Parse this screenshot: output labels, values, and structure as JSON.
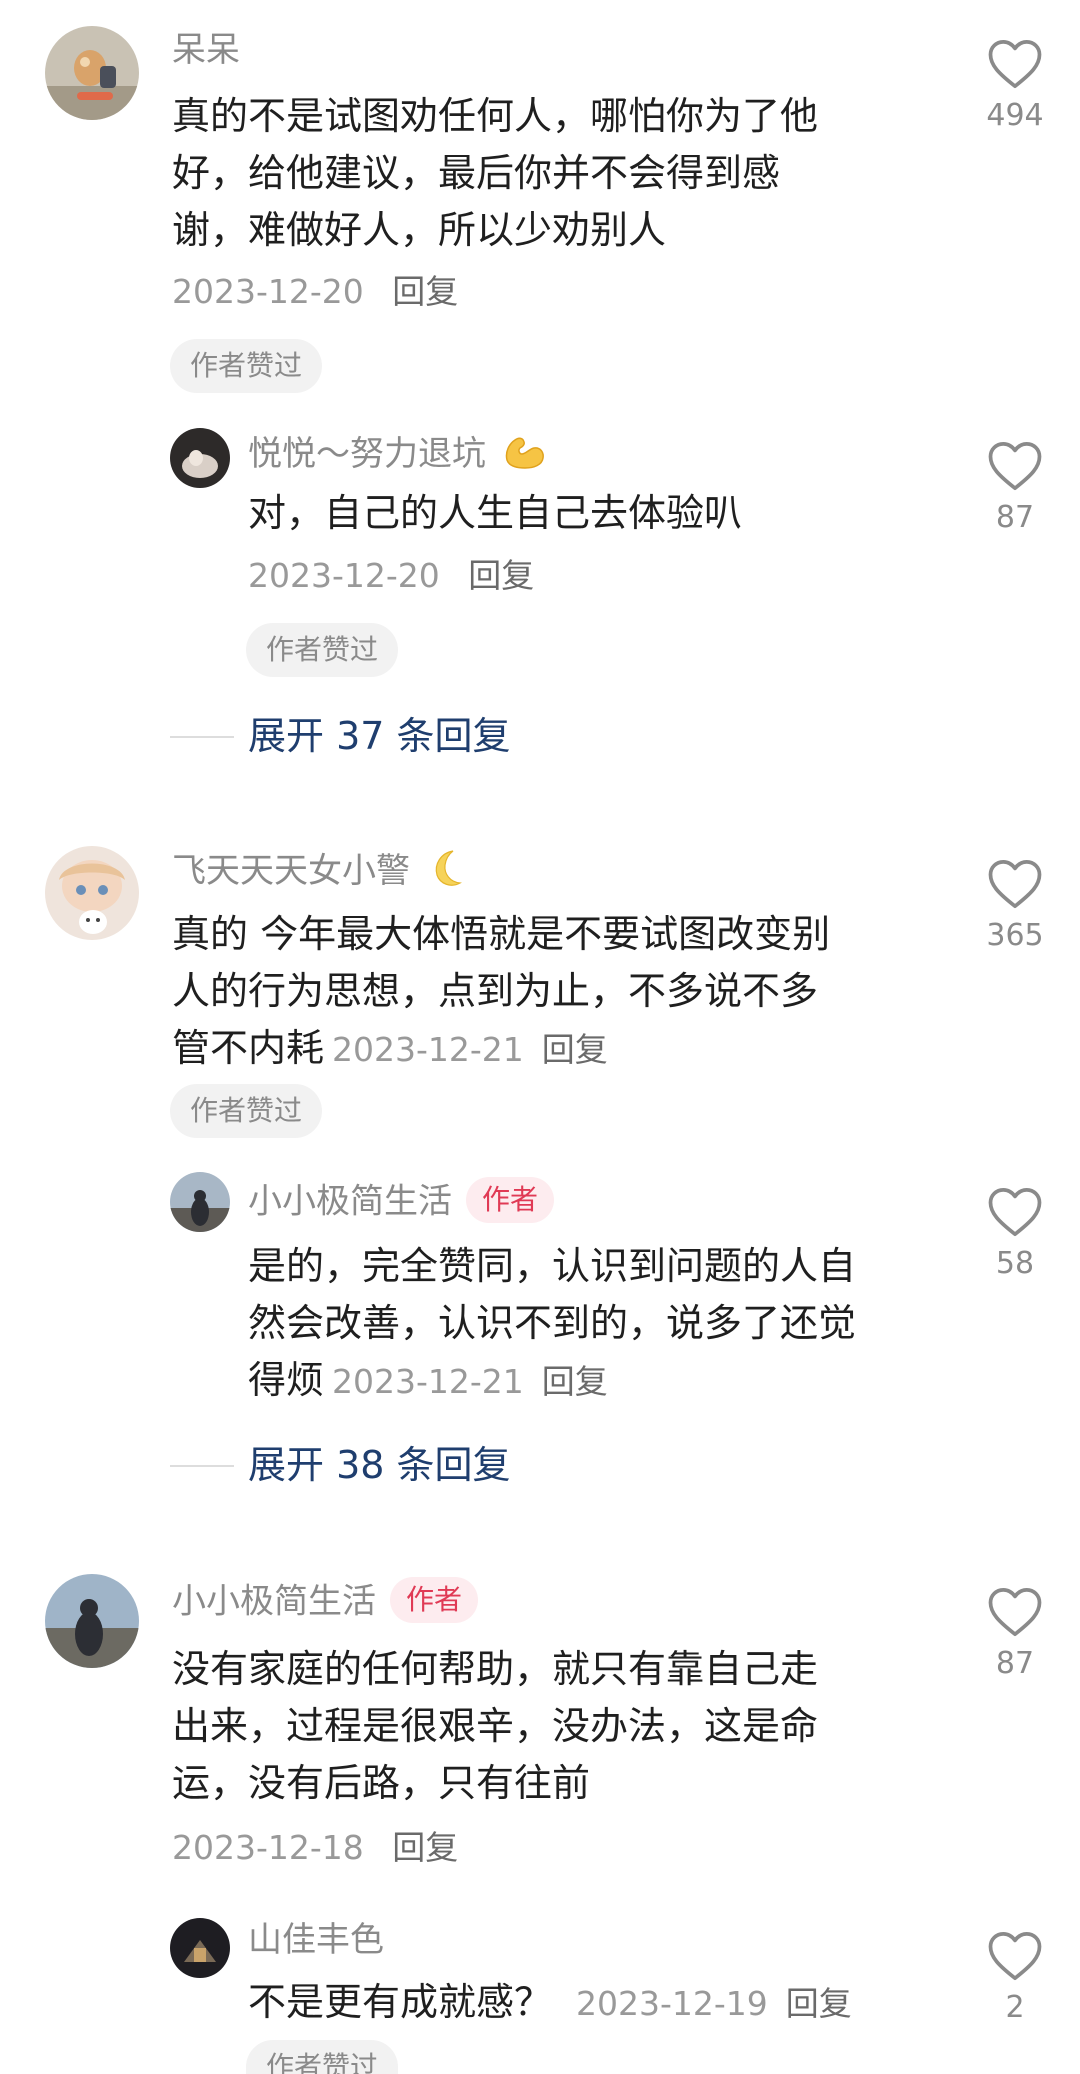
{
  "comments": [
    {
      "user": "呆呆",
      "text_lines": [
        "真的不是试图劝任何人，哪怕你为了他",
        "好，给他建议，最后你并不会得到感",
        "谢，难做好人，所以少劝别人"
      ],
      "date": "2023-12-20",
      "reply_label": "回复",
      "liked_label": "作者赞过",
      "likes": "494",
      "replies": [
        {
          "user": "悦悦～努力退坑",
          "emoji": "flexed-biceps-emoji",
          "text": "对，自己的人生自己去体验叭",
          "date": "2023-12-20",
          "reply_label": "回复",
          "liked_label": "作者赞过",
          "likes": "87"
        }
      ],
      "expand_label": "展开 37 条回复"
    },
    {
      "user": "飞天天天女小警",
      "emoji": "crescent-moon-emoji",
      "text_lines": [
        "真的 今年最大体悟就是不要试图改变别",
        "人的行为思想，点到为止，不多说不多",
        "管不内耗"
      ],
      "date": "2023-12-21",
      "reply_label": "回复",
      "liked_label": "作者赞过",
      "likes": "365",
      "replies": [
        {
          "user": "小小极简生活",
          "author_tag": "作者",
          "text_lines": [
            "是的，完全赞同，认识到问题的人自",
            "然会改善，认识不到的，说多了还觉",
            "得烦"
          ],
          "date": "2023-12-21",
          "reply_label": "回复",
          "likes": "58"
        }
      ],
      "expand_label": "展开 38 条回复"
    },
    {
      "user": "小小极简生活",
      "author_tag": "作者",
      "text_lines": [
        "没有家庭的任何帮助，就只有靠自己走",
        "出来，过程是很艰辛，没办法，这是命",
        "运，没有后路，只有往前"
      ],
      "date": "2023-12-18",
      "reply_label": "回复",
      "likes": "87",
      "replies": [
        {
          "user": "山佳丰色",
          "text": "不是更有成就感？",
          "date": "2023-12-19",
          "reply_label": "回复",
          "liked_label": "作者赞过",
          "likes": "2"
        }
      ]
    }
  ],
  "colors": {
    "username": "#8a8a8a",
    "body_text": "#1f1f1f",
    "meta": "#999999",
    "author_tag_bg": "#fdecef",
    "author_tag_text": "#e03a55",
    "expand_link": "#1f3e6e",
    "liked_pill_bg": "#f2f2f2"
  },
  "icons": {
    "like": "heart-outline-icon"
  }
}
